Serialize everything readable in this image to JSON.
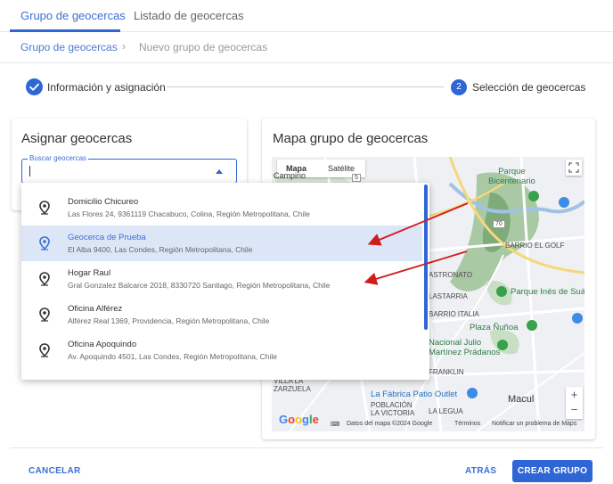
{
  "tabs": [
    {
      "label": "Grupo de geocercas",
      "active": true
    },
    {
      "label": "Listado de geocercas",
      "active": false
    }
  ],
  "breadcrumb": {
    "parent": "Grupo de geocercas",
    "separator": "›",
    "current": "Nuevo grupo de geocercas"
  },
  "stepper": {
    "step1_label": "Información y asignación",
    "step2_number": "2",
    "step2_label": "Selección de geocercas"
  },
  "assign_panel": {
    "title": "Asignar geocercas",
    "search_label": "Buscar geocercas",
    "search_value": ""
  },
  "map_panel": {
    "title": "Mapa grupo de geocercas",
    "map_type": {
      "map": "Mapa",
      "satellite": "Satélite"
    },
    "labels": {
      "campino": "Campino",
      "parque_bicentenario": "Parque\nBicentenario",
      "barrio_el_golf": "BARRIO EL GOLF",
      "astronato": "ASTRONATO",
      "lastarria": "LASTARRIA",
      "parque_ines": "Parque Inés de Suár",
      "barrio_italia": "BARRIO ITALIA",
      "plaza_nunoa": "Plaza Ñuñoa",
      "estadio": "Nacional Julio\nMartínez Prádanos",
      "franklin": "FRANKLIN",
      "villa_la": "VILLA LA",
      "zarzuela": "ZARZUELA",
      "la_fabrica": "La Fábrica Patio Outlet",
      "poblacion": "POBLACIÓN\nLA VICTORIA",
      "la_legua": "LA LEGUA",
      "macul": "Macul",
      "route_70": "70",
      "route_5": "5"
    },
    "google": "Google",
    "attribution": {
      "data": "Datos del mapa ©2024 Google",
      "terms": "Términos",
      "report": "Notificar un problema de Maps"
    },
    "zoom_in": "+",
    "zoom_out": "−"
  },
  "options": [
    {
      "name": "Domicilio Chicureo",
      "address": "Las Flores 24, 9361119 Chacabuco, Colina, Región Metropolitana, Chile",
      "selected": false
    },
    {
      "name": "Geocerca de Prueba",
      "address": "El Alba 9400, Las Condes, Región Metropolitana, Chile",
      "selected": true
    },
    {
      "name": "Hogar Raul",
      "address": "Gral Gonzalez Balcarce 2018, 8330720 Santiago, Región Metropolitana, Chile",
      "selected": false
    },
    {
      "name": "Oficina Alférez",
      "address": "Alférez Real 1369, Providencia, Región Metropolitana, Chile",
      "selected": false
    },
    {
      "name": "Oficina Apoquindo",
      "address": "Av. Apoquindo 4501, Las Condes, Región Metropolitana, Chile",
      "selected": false
    }
  ],
  "footer": {
    "cancel": "CANCELAR",
    "back": "ATRÁS",
    "create": "CREAR GRUPO"
  },
  "colors": {
    "primary": "#2f66d6",
    "selected_row": "#dce6f7",
    "annotation_arrow": "#d11a1a"
  },
  "icons": {
    "step_done": "check-icon",
    "option": "map-pin-icon",
    "fullscreen": "fullscreen-icon"
  }
}
